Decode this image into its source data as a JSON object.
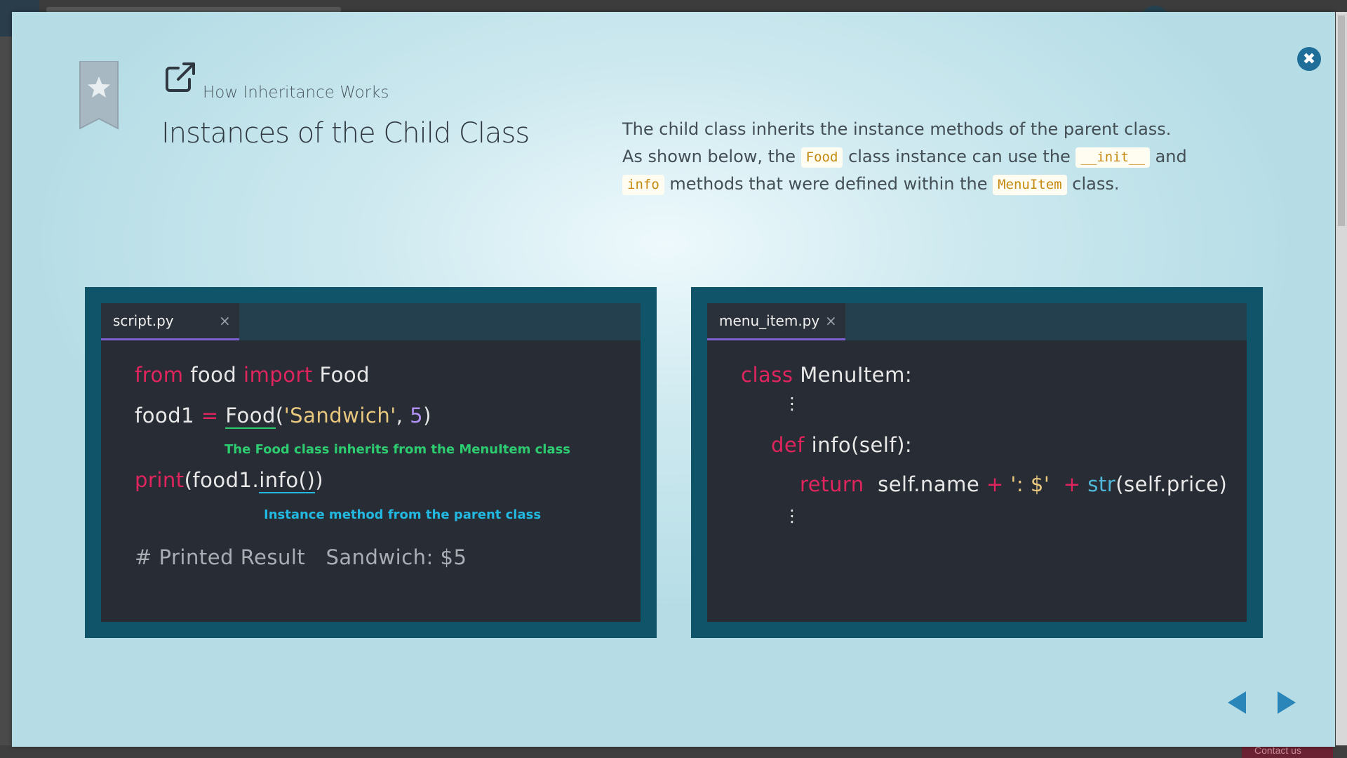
{
  "lesson": {
    "label": "How Inheritance Works",
    "title": "Instances of the Child Class"
  },
  "description": {
    "line1": "The child class inherits the instance methods of the parent class.",
    "line2_before": "As shown below, the ",
    "chip_food": "Food",
    "line2_middle": " class instance can use the ",
    "chip_init": "__init__",
    "line2_after": " and",
    "chip_info": "info",
    "line3_middle": " methods that were defined within the ",
    "chip_menuitem": "MenuItem",
    "line3_after": " class."
  },
  "left_editor": {
    "tab_label": "script.py",
    "close_glyph": "×",
    "line1": {
      "kw1": "from",
      "mod": " food ",
      "kw2": "import",
      "cls": " Food"
    },
    "line2": {
      "var": "food1 ",
      "op": "=",
      "space": " ",
      "call": "Food",
      "paren_open": "(",
      "str": "'Sandwich'",
      "comma": ", ",
      "num": "5",
      "paren_close": ")"
    },
    "annotation1": "The Food class inherits from the MenuItem class",
    "line3": {
      "fn": "print",
      "open": "(food1.",
      "method": "info()",
      "close": ")"
    },
    "annotation2": "Instance method from the parent class",
    "result_comment": "# Printed Result",
    "result_value": "Sandwich: $5"
  },
  "right_editor": {
    "tab_label": "menu_item.py",
    "close_glyph": "×",
    "line1": {
      "kw": "class",
      "rest": " MenuItem:"
    },
    "vdots": "⋮",
    "line2": {
      "kw": "def",
      "rest": " info(self):"
    },
    "line3": {
      "kw": "return",
      "self_name": "  self.name ",
      "op1": "+",
      "str": " ': $' ",
      "op2": " +",
      "fn": "str",
      "rest": "(self.price)"
    }
  },
  "controls": {
    "close_glyph": "✖"
  },
  "colors": {
    "accent": "#0f5468",
    "keyword": "#e0245e",
    "string": "#e8c77e",
    "annotation_green": "#2ecc71",
    "annotation_blue": "#22b8e0",
    "tab_underline": "#7c5fd0"
  },
  "backdrop": {
    "contact_label": "Contact us"
  }
}
